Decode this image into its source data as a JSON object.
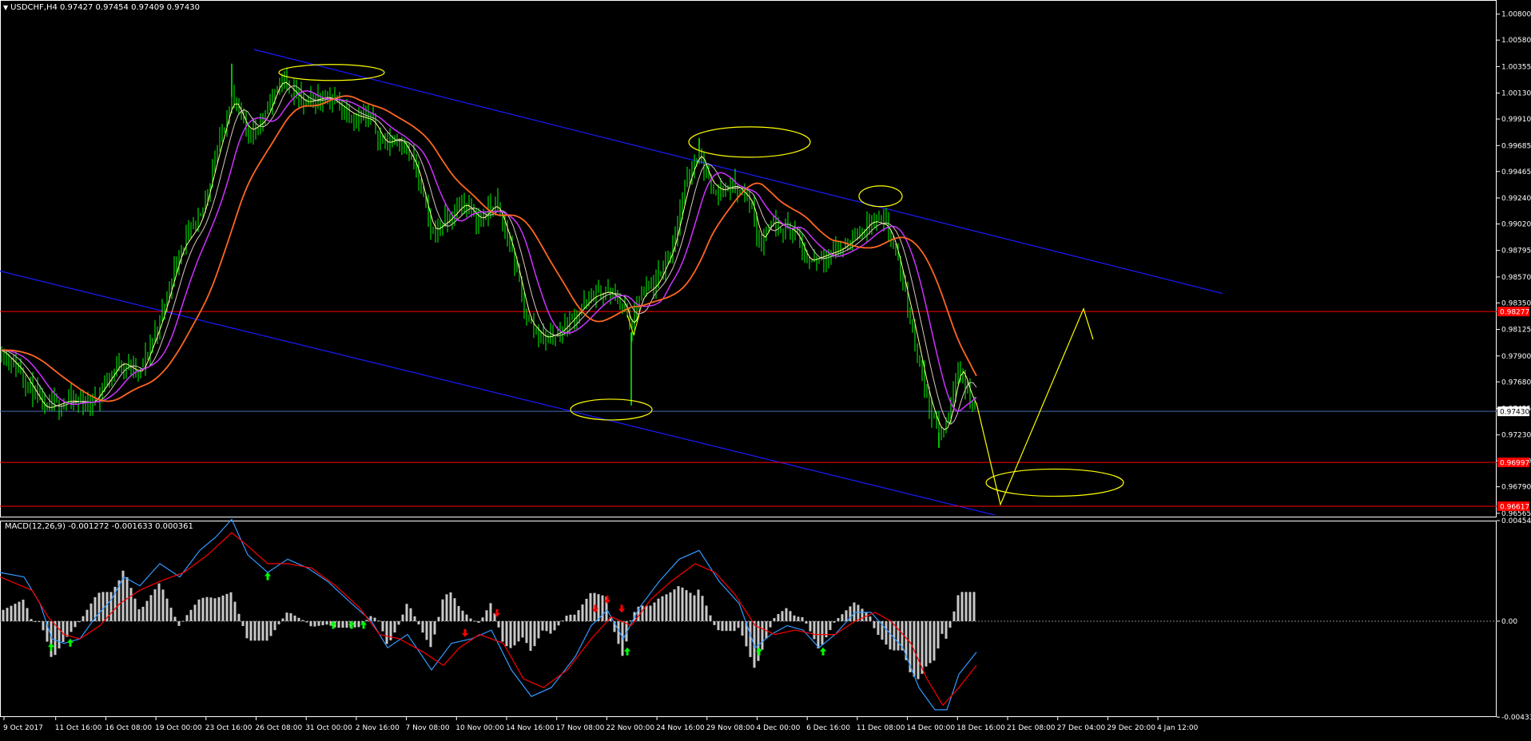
{
  "main_header": "USDCHF,H4  0.97427 0.97454 0.97409 0.97430",
  "macd_header": "MACD(12,26,9) -0.001272 -0.001633 0.000361",
  "colors": {
    "background": "#000000",
    "frame": "#ffffff",
    "candle": "#00ff00",
    "ma_fast": "#ffff99",
    "ma_mid": "#d8c8c0",
    "ma_slow": "#cc33ff",
    "ma_long": "#ff6622",
    "channel": "#1a1aff",
    "level": "#ff0000",
    "current": "#4a6ab0",
    "annotation": "#ffff00",
    "macd_line": "#3399ff",
    "signal_line": "#ff0000",
    "histogram": "#c8c8c8",
    "buy_arrow": "#00ff00",
    "sell_arrow": "#ff0000"
  },
  "chart_data": [
    {
      "type": "candlestick",
      "symbol": "USDCHF",
      "timeframe": "H4",
      "ohlc_current": {
        "open": 0.97427,
        "high": 0.97454,
        "low": 0.97409,
        "close": 0.9743
      },
      "ylim": [
        0.9653,
        1.0092
      ],
      "y_ticks": [
        "1.00800",
        "1.00580",
        "1.00355",
        "1.00130",
        "0.99910",
        "0.99685",
        "0.99465",
        "0.99240",
        "0.99020",
        "0.98795",
        "0.98570",
        "0.98350",
        "0.98125",
        "0.97900",
        "0.97680",
        "0.97455",
        "0.97230",
        "0.97010",
        "0.96790",
        "0.96565"
      ],
      "x_labels": [
        "9 Oct 2017",
        "11 Oct 16:00",
        "16 Oct 08:00",
        "19 Oct 00:00",
        "23 Oct 16:00",
        "26 Oct 08:00",
        "31 Oct 00:00",
        "2 Nov 16:00",
        "7 Nov 08:00",
        "10 Nov 00:00",
        "14 Nov 16:00",
        "17 Nov 08:00",
        "22 Nov 00:00",
        "24 Nov 16:00",
        "29 Nov 08:00",
        "4 Dec 00:00",
        "6 Dec 16:00",
        "11 Dec 08:00",
        "14 Dec 00:00",
        "18 Dec 16:00",
        "21 Dec 08:00",
        "27 Dec 04:00",
        "29 Dec 20:00",
        "4 Jan 12:00"
      ],
      "price_path": [
        [
          0,
          0.9795
        ],
        [
          25,
          0.9778
        ],
        [
          55,
          0.9745
        ],
        [
          85,
          0.9752
        ],
        [
          115,
          0.975
        ],
        [
          150,
          0.9785
        ],
        [
          175,
          0.9775
        ],
        [
          200,
          0.982
        ],
        [
          225,
          0.988
        ],
        [
          250,
          0.9905
        ],
        [
          270,
          0.996
        ],
        [
          290,
          1.001
        ],
        [
          310,
          0.998
        ],
        [
          330,
          0.999
        ],
        [
          350,
          1.0025
        ],
        [
          380,
          1.0005
        ],
        [
          410,
          1.001
        ],
        [
          440,
          0.9995
        ],
        [
          465,
          0.999
        ],
        [
          480,
          0.997
        ],
        [
          500,
          0.9975
        ],
        [
          520,
          0.995
        ],
        [
          540,
          0.9895
        ],
        [
          560,
          0.9905
        ],
        [
          580,
          0.992
        ],
        [
          600,
          0.9905
        ],
        [
          620,
          0.992
        ],
        [
          640,
          0.988
        ],
        [
          660,
          0.982
        ],
        [
          680,
          0.9805
        ],
        [
          700,
          0.981
        ],
        [
          720,
          0.9825
        ],
        [
          740,
          0.984
        ],
        [
          760,
          0.9845
        ],
        [
          780,
          0.9835
        ],
        [
          790,
          0.981
        ],
        [
          800,
          0.984
        ],
        [
          820,
          0.985
        ],
        [
          840,
          0.988
        ],
        [
          860,
          0.994
        ],
        [
          875,
          0.9965
        ],
        [
          885,
          0.994
        ],
        [
          900,
          0.993
        ],
        [
          920,
          0.9935
        ],
        [
          940,
          0.992
        ],
        [
          950,
          0.9885
        ],
        [
          965,
          0.9905
        ],
        [
          980,
          0.99
        ],
        [
          995,
          0.9895
        ],
        [
          1010,
          0.987
        ],
        [
          1030,
          0.9875
        ],
        [
          1050,
          0.988
        ],
        [
          1070,
          0.989
        ],
        [
          1090,
          0.9905
        ],
        [
          1110,
          0.99
        ],
        [
          1120,
          0.988
        ],
        [
          1140,
          0.982
        ],
        [
          1160,
          0.9755
        ],
        [
          1175,
          0.9725
        ],
        [
          1185,
          0.973
        ],
        [
          1200,
          0.9785
        ],
        [
          1210,
          0.976
        ],
        [
          1222,
          0.9743
        ]
      ],
      "spikes": [
        [
          790,
          0.9748
        ],
        [
          290,
          1.0038
        ],
        [
          875,
          0.9975
        ],
        [
          1175,
          0.9712
        ]
      ],
      "levels": {
        "resistance": 0.98277,
        "support": 0.96997,
        "support2": 0.96625
      },
      "level_labels": [
        "0.98277",
        "0.96997",
        "0.96617"
      ],
      "current_price_label": "0.97430",
      "channel_upper": [
        [
          318,
          1.005
        ],
        [
          1530,
          0.9843
        ]
      ],
      "channel_lower": [
        [
          0,
          0.9862
        ],
        [
          1245,
          0.9655
        ]
      ],
      "annotations": {
        "ellipses": [
          [
            415,
            1.00305,
            66,
            10
          ],
          [
            765,
            0.97445,
            51,
            13
          ],
          [
            938,
            0.99715,
            76,
            19
          ],
          [
            1102,
            0.99255,
            27,
            13
          ],
          [
            1320,
            0.96825,
            86,
            17
          ]
        ],
        "forecast_path": [
          [
            1222,
            0.975
          ],
          [
            1252,
            0.9664
          ],
          [
            1356,
            0.983
          ],
          [
            1368,
            0.9804
          ]
        ],
        "small_path": [
          [
            785,
            0.9825
          ],
          [
            793,
            0.9808
          ],
          [
            800,
            0.9825
          ]
        ]
      }
    },
    {
      "type": "macd",
      "params": "12,26,9",
      "values": {
        "macd": -0.001272,
        "signal": -0.001633,
        "histogram": 0.000361
      },
      "ylim": [
        -0.00433,
        0.004544
      ],
      "y_ticks": [
        "0.004544",
        "0.00",
        "-0.004333"
      ],
      "macd_line": [
        [
          0,
          0.0022
        ],
        [
          30,
          0.002
        ],
        [
          50,
          0.0008
        ],
        [
          65,
          -0.0008
        ],
        [
          80,
          -0.001
        ],
        [
          100,
          -0.0008
        ],
        [
          120,
          0.0002
        ],
        [
          140,
          0.001
        ],
        [
          155,
          0.002
        ],
        [
          175,
          0.0016
        ],
        [
          200,
          0.0026
        ],
        [
          225,
          0.002
        ],
        [
          250,
          0.0032
        ],
        [
          270,
          0.0038
        ],
        [
          290,
          0.0046
        ],
        [
          310,
          0.003
        ],
        [
          335,
          0.0022
        ],
        [
          360,
          0.0028
        ],
        [
          385,
          0.0024
        ],
        [
          410,
          0.0018
        ],
        [
          440,
          0.0008
        ],
        [
          465,
          0.0
        ],
        [
          485,
          -0.0012
        ],
        [
          510,
          -0.0006
        ],
        [
          540,
          -0.0022
        ],
        [
          565,
          -0.001
        ],
        [
          590,
          -0.0008
        ],
        [
          615,
          -0.0004
        ],
        [
          640,
          -0.0022
        ],
        [
          665,
          -0.0034
        ],
        [
          690,
          -0.003
        ],
        [
          720,
          -0.0016
        ],
        [
          740,
          -0.0002
        ],
        [
          760,
          0.0005
        ],
        [
          780,
          -0.0008
        ],
        [
          800,
          0.0006
        ],
        [
          825,
          0.0018
        ],
        [
          850,
          0.0028
        ],
        [
          875,
          0.0032
        ],
        [
          900,
          0.0018
        ],
        [
          925,
          0.0008
        ],
        [
          945,
          -0.0012
        ],
        [
          965,
          -0.0006
        ],
        [
          985,
          -0.0002
        ],
        [
          1005,
          -0.0004
        ],
        [
          1025,
          -0.0012
        ],
        [
          1045,
          -0.0006
        ],
        [
          1070,
          0.0004
        ],
        [
          1090,
          0.0004
        ],
        [
          1110,
          -0.0004
        ],
        [
          1130,
          -0.0012
        ],
        [
          1150,
          -0.003
        ],
        [
          1170,
          -0.004
        ],
        [
          1185,
          -0.004
        ],
        [
          1200,
          -0.0024
        ],
        [
          1222,
          -0.0014
        ]
      ],
      "signal_line": [
        [
          0,
          0.002
        ],
        [
          40,
          0.0014
        ],
        [
          60,
          0.0002
        ],
        [
          80,
          -0.0006
        ],
        [
          100,
          -0.0008
        ],
        [
          125,
          -0.0002
        ],
        [
          150,
          0.0008
        ],
        [
          175,
          0.0014
        ],
        [
          200,
          0.0018
        ],
        [
          230,
          0.0022
        ],
        [
          260,
          0.003
        ],
        [
          290,
          0.004
        ],
        [
          310,
          0.0034
        ],
        [
          335,
          0.0026
        ],
        [
          360,
          0.0026
        ],
        [
          390,
          0.0024
        ],
        [
          420,
          0.0016
        ],
        [
          450,
          0.0006
        ],
        [
          475,
          -0.0006
        ],
        [
          500,
          -0.0008
        ],
        [
          530,
          -0.0014
        ],
        [
          555,
          -0.002
        ],
        [
          575,
          -0.0012
        ],
        [
          600,
          -0.0006
        ],
        [
          630,
          -0.001
        ],
        [
          655,
          -0.0026
        ],
        [
          680,
          -0.003
        ],
        [
          710,
          -0.0022
        ],
        [
          740,
          -0.0008
        ],
        [
          765,
          0.0002
        ],
        [
          790,
          -0.0002
        ],
        [
          815,
          0.001
        ],
        [
          840,
          0.0018
        ],
        [
          870,
          0.0026
        ],
        [
          895,
          0.0022
        ],
        [
          920,
          0.0012
        ],
        [
          945,
          -0.0002
        ],
        [
          970,
          -0.0006
        ],
        [
          995,
          -0.0004
        ],
        [
          1020,
          -0.0006
        ],
        [
          1045,
          -0.0006
        ],
        [
          1070,
          0.0
        ],
        [
          1095,
          0.0004
        ],
        [
          1115,
          0.0
        ],
        [
          1140,
          -0.001
        ],
        [
          1160,
          -0.0026
        ],
        [
          1180,
          -0.0038
        ],
        [
          1200,
          -0.003
        ],
        [
          1222,
          -0.002
        ]
      ],
      "buy_arrows": [
        [
          64,
          -0.0012
        ],
        [
          88,
          -0.001
        ],
        [
          335,
          0.002
        ],
        [
          417,
          -0.0002
        ],
        [
          440,
          -0.0002
        ],
        [
          455,
          -0.0002
        ],
        [
          785,
          -0.0014
        ],
        [
          950,
          -0.0014
        ],
        [
          1030,
          -0.0014
        ]
      ],
      "sell_arrows": [
        [
          582,
          -0.0005
        ],
        [
          622,
          0.0004
        ],
        [
          745,
          0.0006
        ],
        [
          760,
          0.001
        ],
        [
          778,
          0.0006
        ]
      ]
    }
  ]
}
